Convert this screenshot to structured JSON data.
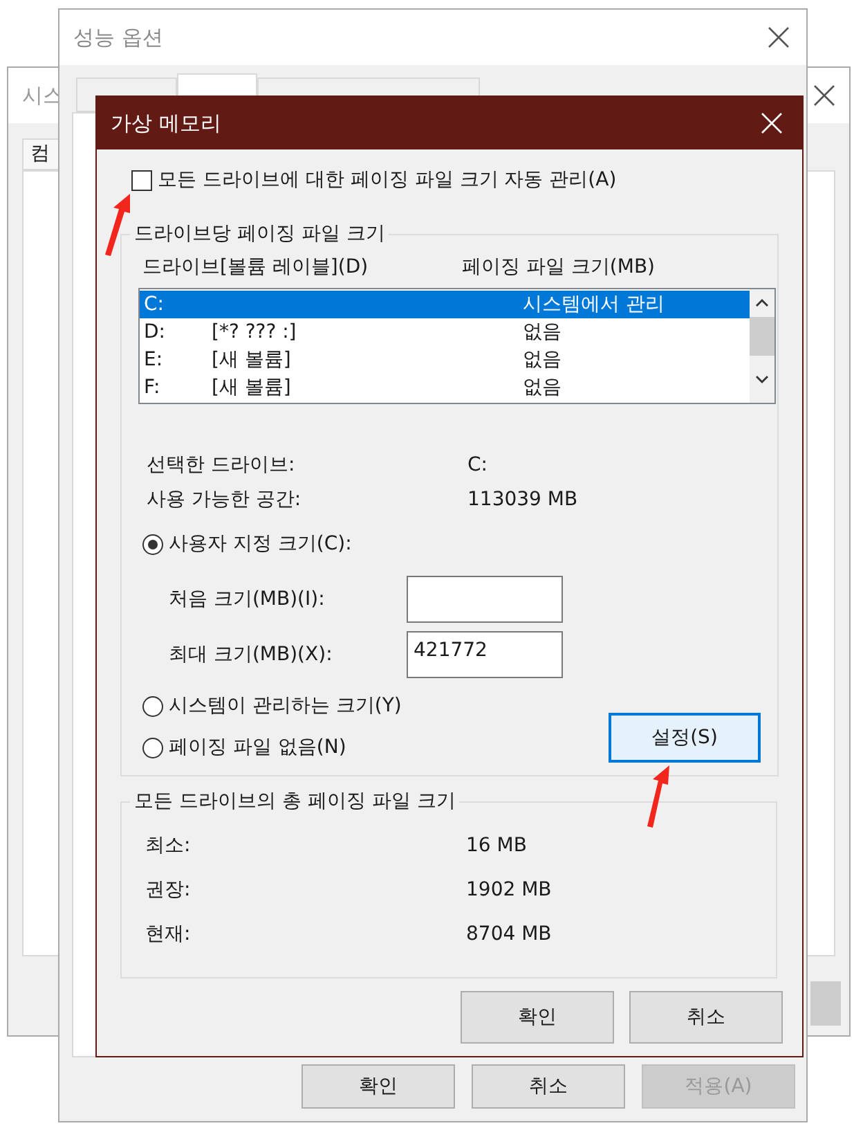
{
  "background_window": {
    "title": "시스",
    "tab": "컴"
  },
  "performance_window": {
    "title": "성능 옵션",
    "tabs": [
      {
        "selected": false
      },
      {
        "selected": true
      },
      {
        "selected": false
      }
    ],
    "buttons": [
      {
        "label": "확인",
        "disabled": false
      },
      {
        "label": "취소",
        "disabled": false
      },
      {
        "label": "적용(A)",
        "disabled": true
      }
    ]
  },
  "dialog": {
    "title": "가상 메모리",
    "auto_manage": {
      "label": "모든 드라이브에 대한 페이징 파일 크기 자동 관리(A)",
      "checked": false
    },
    "per_drive": {
      "title": "드라이브당 페이징 파일 크기",
      "columns": [
        "드라이브[볼륨 레이블](D)",
        "페이징 파일 크기(MB)"
      ],
      "drives": [
        {
          "drive": "C:",
          "size": "시스템에서 관리",
          "selected": true
        },
        {
          "drive": "D:",
          "label": "[*? ??? :]",
          "size": "없음",
          "selected": false
        },
        {
          "drive": "E:",
          "label": "[새 볼륨]",
          "size": "없음",
          "selected": false
        },
        {
          "drive": "F:",
          "label": "[새 볼륨]",
          "size": "없음",
          "selected": false
        }
      ],
      "info": [
        {
          "label": "선택한 드라이브:",
          "value": "C:"
        },
        {
          "label": "사용 가능한 공간:",
          "value": "113039 MB"
        }
      ],
      "options": [
        {
          "label": "사용자 지정 크기(C):",
          "selected": true
        },
        {
          "label": "시스템이 관리하는 크기(Y)",
          "selected": false
        },
        {
          "label": "페이징 파일 없음(N)",
          "selected": false
        }
      ],
      "fields": [
        {
          "label": "처음 크기(MB)(I):"
        },
        {
          "label": "최대 크기(MB)(X):",
          "value": "421772"
        }
      ],
      "set_button": "설정(S)"
    },
    "totals": {
      "title": "모든 드라이브의 총 페이징 파일 크기",
      "rows": [
        {
          "label": "최소:",
          "value": "16 MB"
        },
        {
          "label": "권장:",
          "value": "1902 MB"
        },
        {
          "label": "현재:",
          "value": "8704 MB"
        }
      ]
    },
    "buttons": [
      "확인",
      "취소"
    ]
  }
}
